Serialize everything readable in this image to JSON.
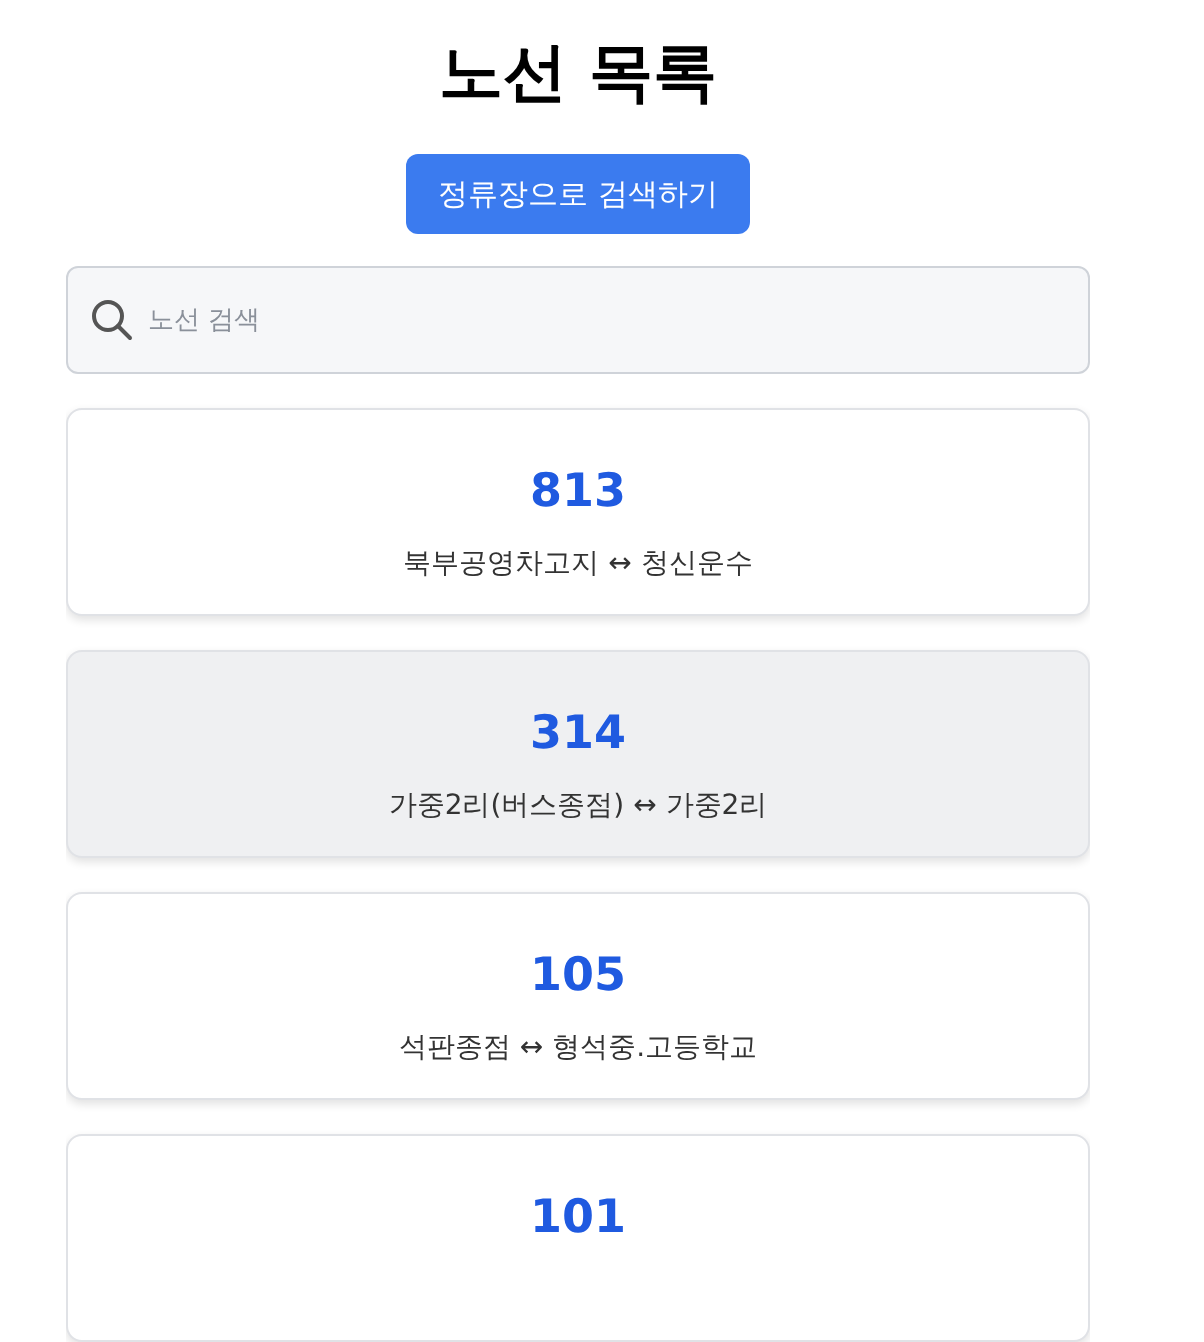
{
  "title": "노선 목록",
  "stop_search_button": "정류장으로 검색하기",
  "search": {
    "placeholder": "노선 검색"
  },
  "routes": [
    {
      "number": "813",
      "endpoints": "북부공영차고지 ↔ 청신운수",
      "selected": false
    },
    {
      "number": "314",
      "endpoints": "가중2리(버스종점) ↔ 가중2리",
      "selected": true
    },
    {
      "number": "105",
      "endpoints": "석판종점 ↔ 형석중.고등학교",
      "selected": false
    },
    {
      "number": "101",
      "selected": false
    }
  ]
}
